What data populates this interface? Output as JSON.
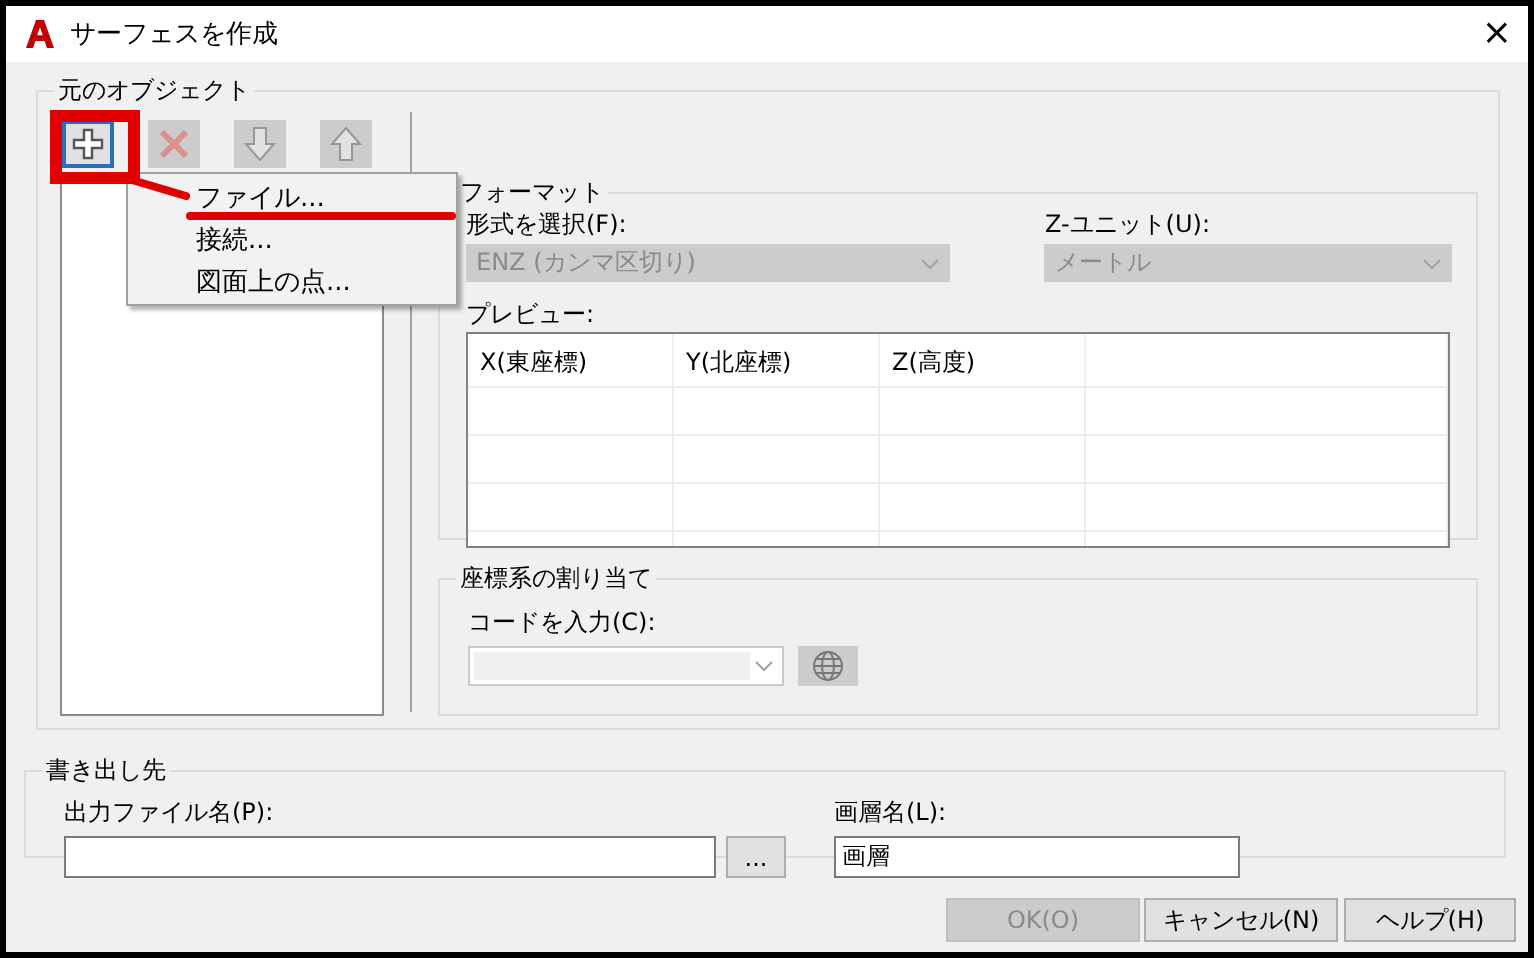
{
  "window": {
    "title": "サーフェスを作成",
    "close": "×"
  },
  "source_objects": {
    "label": "元のオブジェクト",
    "toolbar": [
      {
        "kind": "add",
        "disabled": false,
        "highlighted": true
      },
      {
        "kind": "delete",
        "disabled": true,
        "highlighted": false
      },
      {
        "kind": "down",
        "disabled": true,
        "highlighted": false
      },
      {
        "kind": "up",
        "disabled": true,
        "highlighted": false
      }
    ]
  },
  "context_menu": {
    "items": [
      {
        "label": "ファイル...",
        "highlighted": true
      },
      {
        "label": "接続...",
        "highlighted": false
      },
      {
        "label": "図面上の点...",
        "highlighted": false
      }
    ]
  },
  "format": {
    "label": "フォーマット",
    "format_select": {
      "label": "形式を選択(F):",
      "value": "ENZ (カンマ区切り)",
      "disabled": true
    },
    "z_unit_select": {
      "label": "Z-ユニット(U):",
      "value": "メートル",
      "disabled": true
    },
    "preview": {
      "label": "プレビュー:",
      "columns": [
        "X(東座標)",
        "Y(北座標)",
        "Z(高度)"
      ]
    }
  },
  "coordinate_system": {
    "label": "座標系の割り当て",
    "code_field": {
      "label": "コードを入力(C):",
      "disabled": true
    },
    "globe_button": {
      "disabled": true
    }
  },
  "export": {
    "label": "書き出し先",
    "output_file": {
      "label": "出力ファイル名(P):",
      "browse": "..."
    },
    "layer_name": {
      "label": "画層名(L):",
      "value": "画層"
    }
  },
  "buttons": [
    {
      "label": "OK(O)",
      "disabled": true
    },
    {
      "label": "キャンセル(N)",
      "disabled": false
    },
    {
      "label": "ヘルプ(H)",
      "disabled": false
    }
  ]
}
